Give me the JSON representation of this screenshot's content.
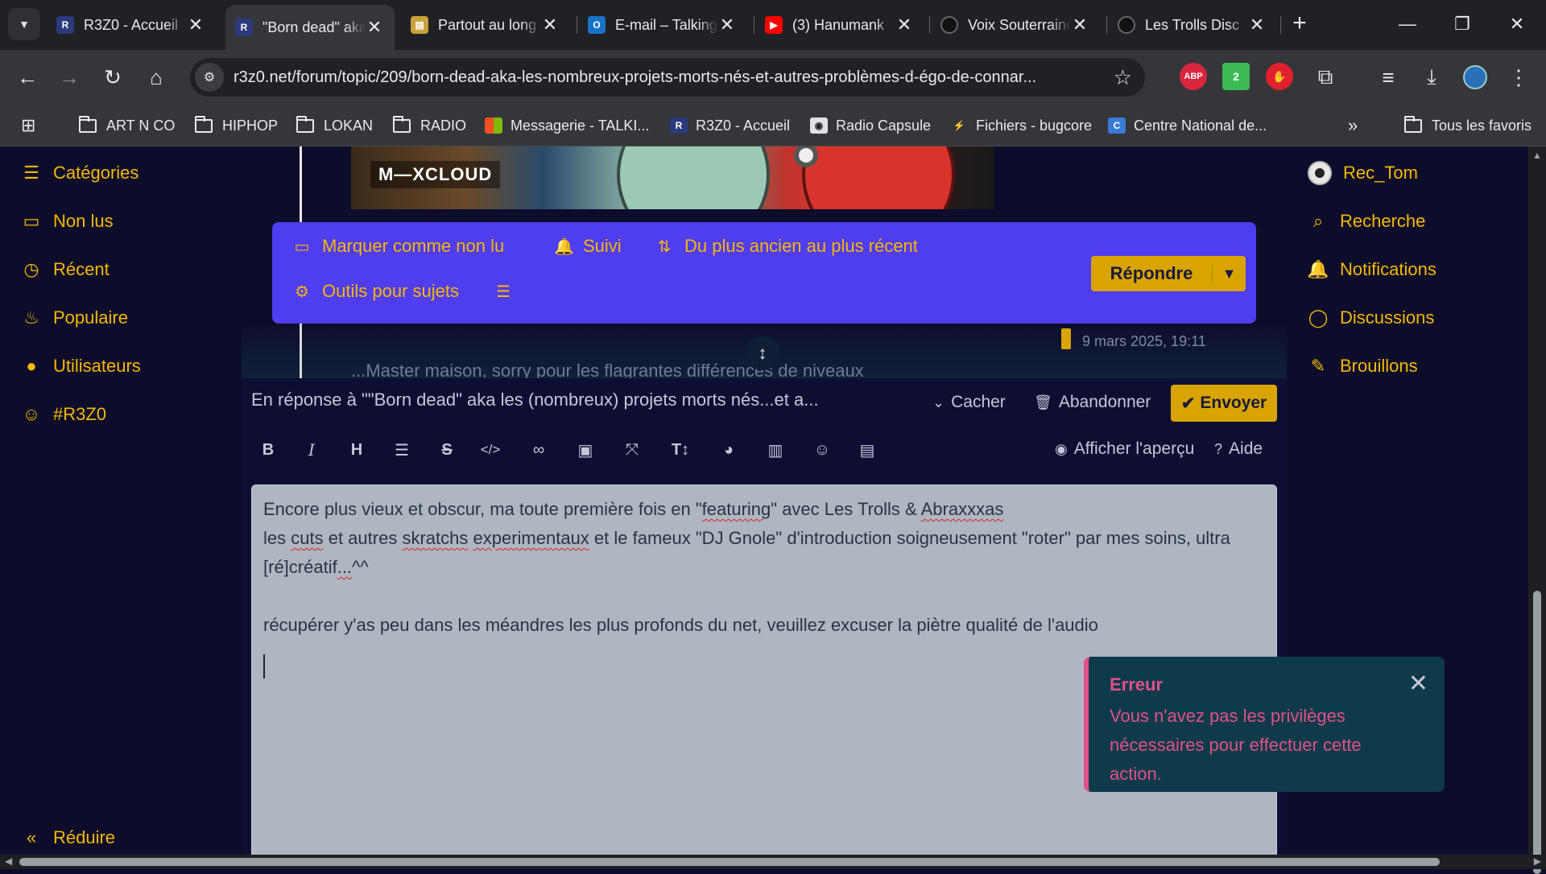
{
  "browser": {
    "tabs": [
      {
        "title": "R3Z0 - Accueil",
        "icon": "r3z0-favicon",
        "color": "#2a3a7a",
        "active": false
      },
      {
        "title": "\"Born dead\" aka",
        "icon": "r3z0-favicon",
        "color": "#2a3a7a",
        "active": true
      },
      {
        "title": "Partout au long",
        "icon": "document-favicon",
        "color": "#c9a23a",
        "active": false
      },
      {
        "title": "E-mail – Talking",
        "icon": "outlook-favicon",
        "color": "#1a73c8",
        "active": false
      },
      {
        "title": "(3) Hanumank",
        "icon": "youtube-favicon",
        "color": "#ff0000",
        "active": false
      },
      {
        "title": "Voix Souterraines",
        "icon": "disc-favicon",
        "color": "#111111",
        "active": false
      },
      {
        "title": "Les Trolls Disc",
        "icon": "disc-favicon",
        "color": "#111111",
        "active": false
      }
    ],
    "url": "r3z0.net/forum/topic/209/born-dead-aka-les-nombreux-projets-morts-nés-et-autres-problèmes-d-égo-de-connar...",
    "extensions": [
      {
        "name": "adblock-plus-icon",
        "label": "ABP",
        "color": "#d7263d"
      },
      {
        "name": "extension-2-icon",
        "label": "2",
        "color": "#3cba54"
      },
      {
        "name": "ublock-icon",
        "label": "✋",
        "color": "#e0202e"
      }
    ],
    "bookmarks": [
      {
        "label": "ART N CO",
        "type": "folder"
      },
      {
        "label": "HIPHOP",
        "type": "folder"
      },
      {
        "label": "LOKAN",
        "type": "folder"
      },
      {
        "label": "RADIO",
        "type": "folder"
      },
      {
        "label": "Messagerie - TALKI...",
        "type": "microsoft"
      },
      {
        "label": "R3Z0 - Accueil",
        "type": "r3z0"
      },
      {
        "label": "Radio Capsule",
        "type": "radio"
      },
      {
        "label": "Fichiers - bugcore",
        "type": "bugcore"
      },
      {
        "label": "Centre National de...",
        "type": "cnc"
      }
    ],
    "all_bookmarks": "Tous les favoris",
    "overflow": "»"
  },
  "left_nav": [
    {
      "label": "Catégories",
      "icon": "list-icon",
      "glyph": "☰"
    },
    {
      "label": "Non lus",
      "icon": "inbox-icon",
      "glyph": "▭"
    },
    {
      "label": "Récent",
      "icon": "clock-icon",
      "glyph": "◷"
    },
    {
      "label": "Populaire",
      "icon": "fire-icon",
      "glyph": "♨"
    },
    {
      "label": "Utilisateurs",
      "icon": "user-icon",
      "glyph": "●"
    },
    {
      "label": "#R3Z0",
      "icon": "chat-icon",
      "glyph": "💬"
    }
  ],
  "collapse_label": "Réduire",
  "right_nav": [
    {
      "label": "Rec_Tom",
      "icon": "avatar"
    },
    {
      "label": "Recherche",
      "icon": "search-icon",
      "glyph": "⌕"
    },
    {
      "label": "Notifications",
      "icon": "bell-icon",
      "glyph": "🔔"
    },
    {
      "label": "Discussions",
      "icon": "comment-icon",
      "glyph": "◯"
    },
    {
      "label": "Brouillons",
      "icon": "edit-icon",
      "glyph": "✎"
    }
  ],
  "embed": {
    "label": "M—XCLOUD"
  },
  "topic_tools": {
    "mark_unread": "Marquer comme non lu",
    "follow": "Suivi",
    "sort": "Du plus ancien au plus récent",
    "tools": "Outils pour sujets",
    "reply": "Répondre"
  },
  "post": {
    "date": "9 mars 2025, 19:11",
    "snippet": "...Master maison, sorry pour les flagrantes différences de niveaux"
  },
  "composer": {
    "reply_to": "En réponse à \"\"Born dead\" aka les (nombreux) projets morts nés...et a...",
    "hide": "Cacher",
    "discard": "Abandonner",
    "send": "Envoyer",
    "preview": "Afficher l'aperçu",
    "help": "Aide",
    "formatting": [
      {
        "name": "bold-button",
        "glyph": "B",
        "cls": "b"
      },
      {
        "name": "italic-button",
        "glyph": "I",
        "cls": "i"
      },
      {
        "name": "heading-button",
        "glyph": "H",
        "cls": "b"
      },
      {
        "name": "list-button",
        "glyph": "☰",
        "cls": ""
      },
      {
        "name": "strikethrough-button",
        "glyph": "S̶",
        "cls": ""
      },
      {
        "name": "code-button",
        "glyph": "</>",
        "cls": ""
      },
      {
        "name": "link-button",
        "glyph": "🔗",
        "cls": ""
      },
      {
        "name": "image-button",
        "glyph": "▣",
        "cls": ""
      },
      {
        "name": "zen-mode-button",
        "glyph": "⤧",
        "cls": ""
      },
      {
        "name": "text-size-button",
        "glyph": "Tↆ",
        "cls": "b"
      },
      {
        "name": "color-button",
        "glyph": "◕",
        "cls": ""
      },
      {
        "name": "chart-button",
        "glyph": "▥",
        "cls": ""
      },
      {
        "name": "emoji-button",
        "glyph": "☺",
        "cls": ""
      },
      {
        "name": "file-upload-button",
        "glyph": "▤",
        "cls": ""
      }
    ],
    "body": {
      "line1a": "Encore plus vieux et obscur, ma toute première fois en \"",
      "line1_sp1": "featuring",
      "line1b": "\" avec Les Trolls & ",
      "line1_sp2": "Abraxxxas",
      "line2a": "les ",
      "line2_sp1": "cuts",
      "line2b": " et autres ",
      "line2_sp2": "skratchs",
      "line2c": " ",
      "line2_sp3": "experimentaux",
      "line2d": " et le fameux \"DJ Gnole\" d'introduction soigneusement \"roter\" par mes soins, ultra [ré]créatif",
      "line2_sp4": "...",
      "line2e": "^^",
      "line3": "récupérer y'as peu dans les méandres les plus profonds du net, veuillez excuser la piètre qualité de l'audio"
    }
  },
  "toast": {
    "title": "Erreur",
    "message": "Vous n'avez pas les privilèges nécessaires pour effectuer cette action."
  },
  "colors": {
    "accent": "#f5b800",
    "topic_bar": "#4f3df0",
    "error": "#e0508a",
    "background": "#0d0d2b"
  }
}
